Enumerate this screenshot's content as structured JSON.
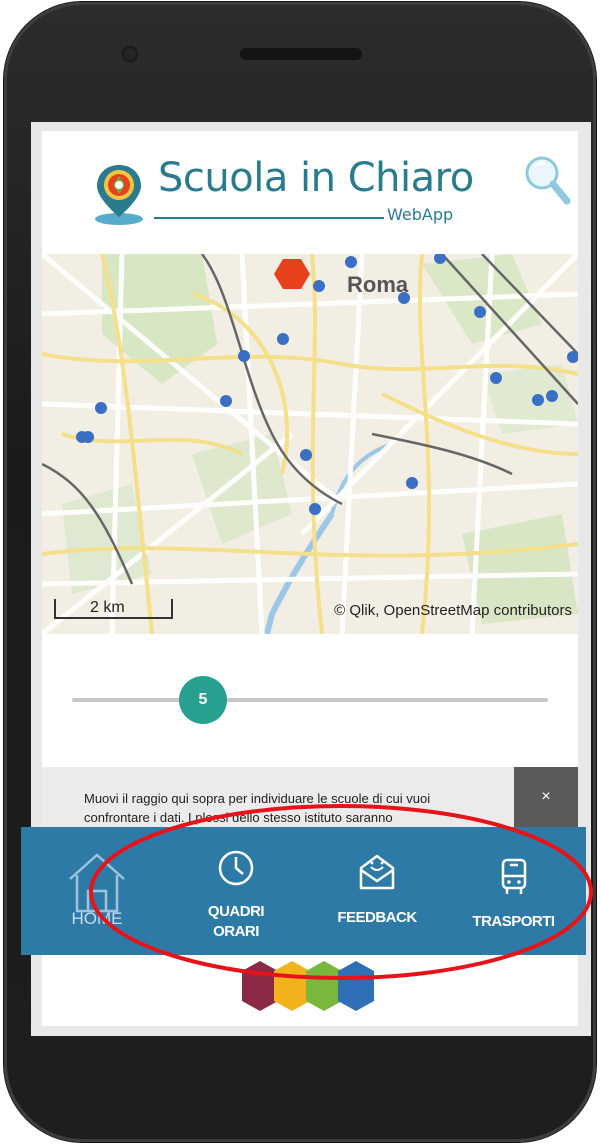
{
  "app": {
    "title": "Scuola in Chiaro",
    "subtitle": "WebApp"
  },
  "map": {
    "city_label": "Roma",
    "scale_label": "2 km",
    "attribution": "© Qlik, OpenStreetMap contributors"
  },
  "slider": {
    "value": "5"
  },
  "notice": {
    "text": "Muovi il raggio qui sopra per individuare le scuole di cui vuoi confrontare i dati. I plessi dello stesso istituto saranno",
    "close_label": "×"
  },
  "nav": {
    "home": "HOME",
    "quadri_line1": "QUADRI",
    "quadri_line2": "ORARI",
    "feedback": "FEEDBACK",
    "trasporti": "TRASPORTI"
  },
  "colors": {
    "brand": "#2b7b8f",
    "navbar": "#2e7aa6",
    "slider_thumb": "#27a08f",
    "school_marker": "#3a6fc4",
    "selected_marker": "#e8401c",
    "annotation": "#e6131b"
  },
  "icons": [
    "search-icon",
    "map-pin-icon",
    "home-icon",
    "clock-icon",
    "feedback-envelope-icon",
    "bus-icon"
  ]
}
